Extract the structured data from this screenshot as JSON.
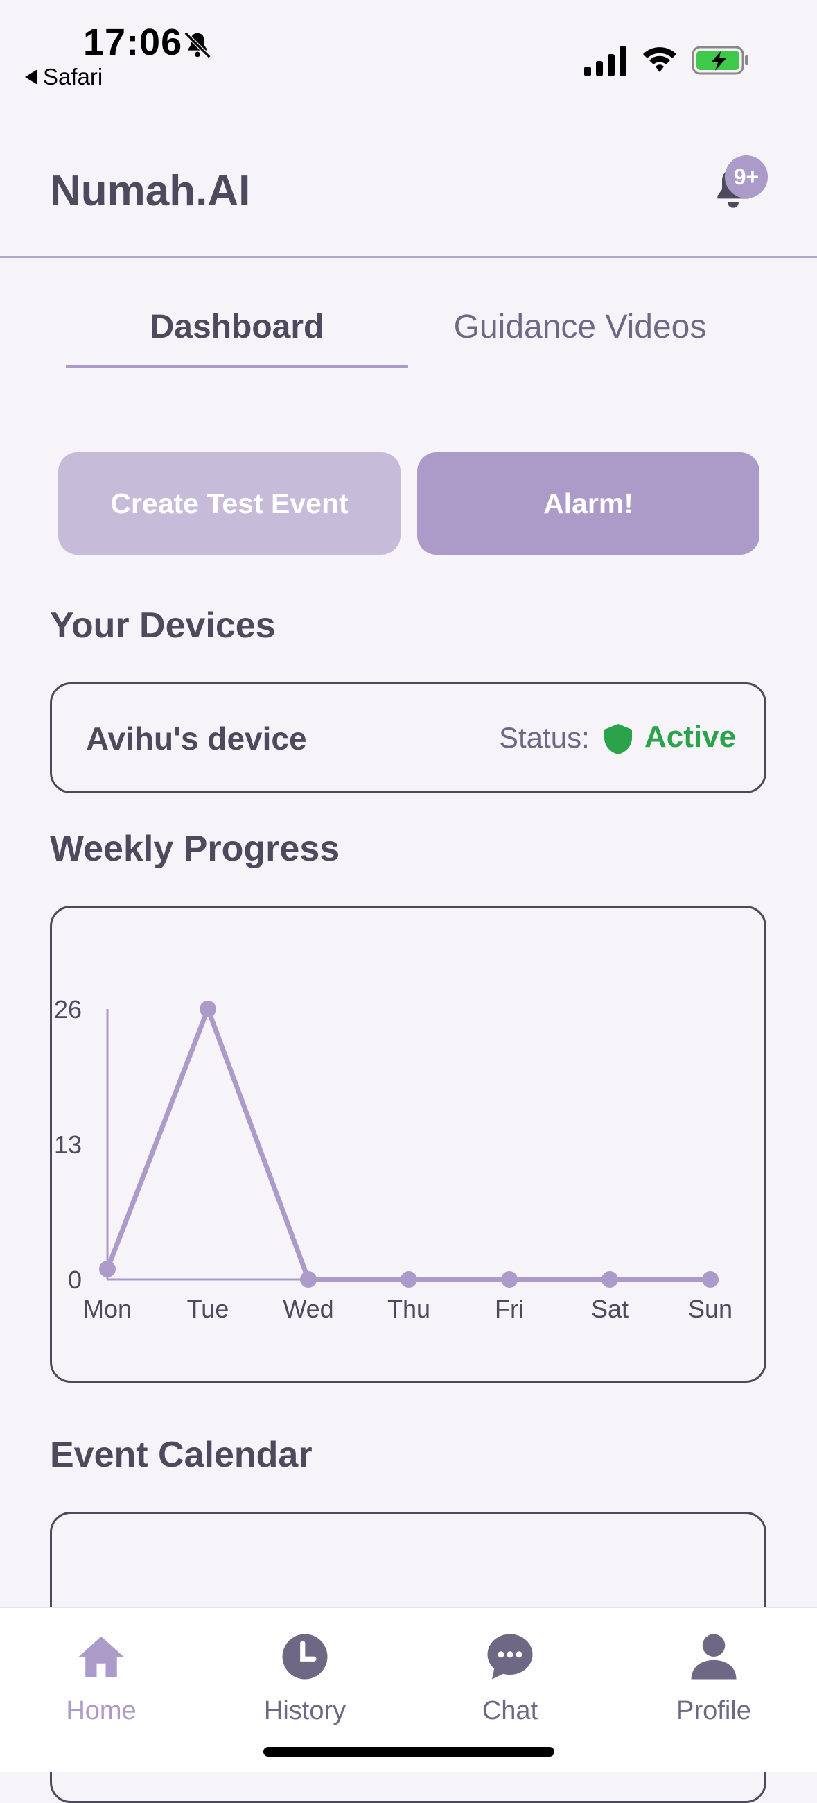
{
  "status_bar": {
    "time": "17:06",
    "back_label": "Safari"
  },
  "header": {
    "title": "Numah.AI",
    "notification_badge": "9+"
  },
  "tabs": [
    {
      "label": "Dashboard",
      "active": true
    },
    {
      "label": "Guidance Videos",
      "active": false
    }
  ],
  "actions": {
    "test_event_label": "Create Test Event",
    "alarm_label": "Alarm!"
  },
  "devices": {
    "title": "Your Devices",
    "items": [
      {
        "name": "Avihu's device",
        "status_label": "Status:",
        "status_value": "Active"
      }
    ]
  },
  "weekly_progress": {
    "title": "Weekly Progress"
  },
  "chart_data": {
    "type": "line",
    "categories": [
      "Mon",
      "Tue",
      "Wed",
      "Thu",
      "Fri",
      "Sat",
      "Sun"
    ],
    "values": [
      1,
      26,
      0,
      0,
      0,
      0,
      0
    ],
    "yticks": [
      0,
      13,
      26
    ],
    "ylim": [
      0,
      26
    ],
    "series_color": "#ac9bc8"
  },
  "calendar": {
    "title": "Event Calendar"
  },
  "bottom_nav": [
    {
      "label": "Home",
      "icon": "home-icon",
      "active": true
    },
    {
      "label": "History",
      "icon": "clock-icon",
      "active": false
    },
    {
      "label": "Chat",
      "icon": "chat-bubble-icon",
      "active": false
    },
    {
      "label": "Profile",
      "icon": "person-icon",
      "active": false
    }
  ],
  "colors": {
    "accent": "#ac9bc8",
    "accent_light": "#c6bcda",
    "text": "#4e4a5e",
    "active_status": "#2aa34a",
    "background": "#f6f3f9"
  }
}
